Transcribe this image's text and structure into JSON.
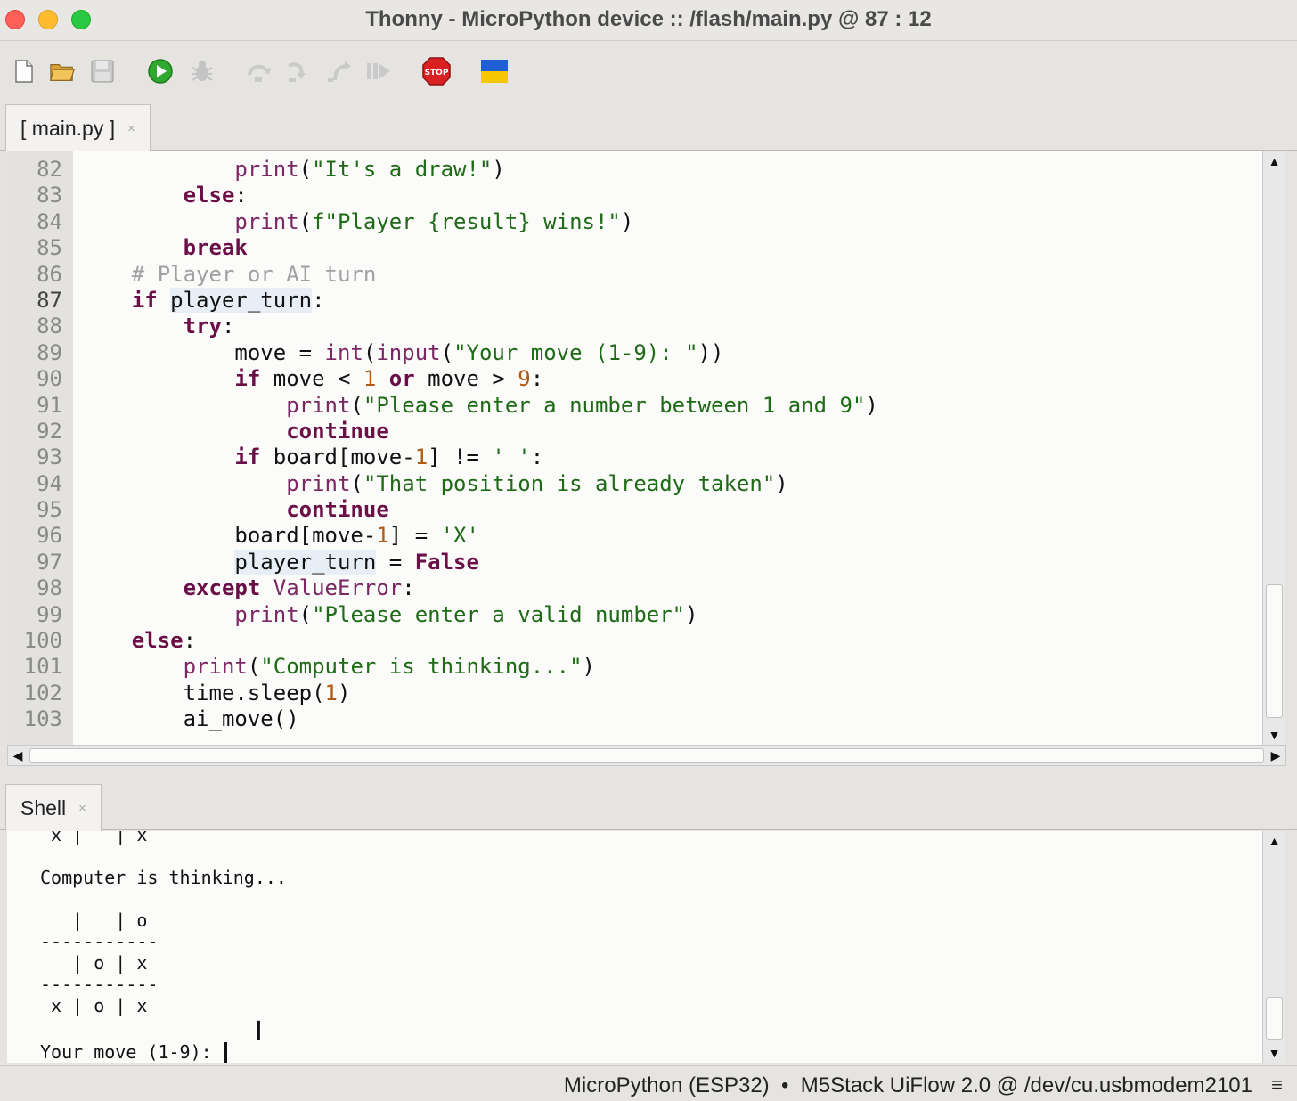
{
  "window": {
    "title": "Thonny  -  MicroPython device :: /flash/main.py  @  87 : 12"
  },
  "toolbar": {
    "buttons": [
      "new-file-icon",
      "open-file-icon",
      "save-icon",
      "run-icon",
      "debug-icon",
      "step-over-icon",
      "step-into-icon",
      "step-out-icon",
      "resume-icon",
      "stop-icon",
      "flag-icon"
    ],
    "stop_label": "STOP",
    "colors": {
      "run": "#2fa82f",
      "stop": "#d92121",
      "flag_blue": "#1f5fd6",
      "flag_yellow": "#f6c700"
    }
  },
  "editor": {
    "tab_label": "[ main.py ]",
    "tab_close": "×",
    "current_line": "87",
    "lines": [
      {
        "n": "82",
        "tokens": [
          [
            "",
            "            "
          ],
          [
            "bi",
            "print"
          ],
          [
            "",
            "("
          ],
          [
            "str",
            "\"It's a draw!\""
          ],
          [
            "",
            ")"
          ]
        ]
      },
      {
        "n": "83",
        "tokens": [
          [
            "",
            "        "
          ],
          [
            "kw",
            "else"
          ],
          [
            "",
            ":"
          ]
        ]
      },
      {
        "n": "84",
        "tokens": [
          [
            "",
            "            "
          ],
          [
            "bi",
            "print"
          ],
          [
            "",
            "("
          ],
          [
            "str",
            "f\"Player {result} wins!\""
          ],
          [
            "",
            ")"
          ]
        ]
      },
      {
        "n": "85",
        "tokens": [
          [
            "",
            "        "
          ],
          [
            "kw",
            "break"
          ]
        ]
      },
      {
        "n": "86",
        "tokens": [
          [
            "",
            "    "
          ],
          [
            "cm",
            "# Player or AI turn"
          ]
        ]
      },
      {
        "n": "87",
        "tokens": [
          [
            "",
            "    "
          ],
          [
            "kw",
            "if"
          ],
          [
            "",
            " "
          ],
          [
            "hl",
            "player_turn"
          ],
          [
            "",
            ":"
          ]
        ]
      },
      {
        "n": "88",
        "tokens": [
          [
            "",
            "        "
          ],
          [
            "kw",
            "try"
          ],
          [
            "",
            ":"
          ]
        ]
      },
      {
        "n": "89",
        "tokens": [
          [
            "",
            "            move = "
          ],
          [
            "bi",
            "int"
          ],
          [
            "",
            "("
          ],
          [
            "bi",
            "input"
          ],
          [
            "",
            "("
          ],
          [
            "str",
            "\"Your move (1-9): \""
          ],
          [
            "",
            "))"
          ]
        ]
      },
      {
        "n": "90",
        "tokens": [
          [
            "",
            "            "
          ],
          [
            "kw",
            "if"
          ],
          [
            "",
            " move < "
          ],
          [
            "num",
            "1"
          ],
          [
            "",
            " "
          ],
          [
            "kw",
            "or"
          ],
          [
            "",
            " move > "
          ],
          [
            "num",
            "9"
          ],
          [
            "",
            ":"
          ]
        ]
      },
      {
        "n": "91",
        "tokens": [
          [
            "",
            "                "
          ],
          [
            "bi",
            "print"
          ],
          [
            "",
            "("
          ],
          [
            "str",
            "\"Please enter a number between 1 and 9\""
          ],
          [
            "",
            ")"
          ]
        ]
      },
      {
        "n": "92",
        "tokens": [
          [
            "",
            "                "
          ],
          [
            "kw",
            "continue"
          ]
        ]
      },
      {
        "n": "93",
        "tokens": [
          [
            "",
            "            "
          ],
          [
            "kw",
            "if"
          ],
          [
            "",
            " board[move-"
          ],
          [
            "num",
            "1"
          ],
          [
            "",
            "] != "
          ],
          [
            "str",
            "' '"
          ],
          [
            "",
            ":"
          ]
        ]
      },
      {
        "n": "94",
        "tokens": [
          [
            "",
            "                "
          ],
          [
            "bi",
            "print"
          ],
          [
            "",
            "("
          ],
          [
            "str",
            "\"That position is already taken\""
          ],
          [
            "",
            ")"
          ]
        ]
      },
      {
        "n": "95",
        "tokens": [
          [
            "",
            "                "
          ],
          [
            "kw",
            "continue"
          ]
        ]
      },
      {
        "n": "96",
        "tokens": [
          [
            "",
            "            board[move-"
          ],
          [
            "num",
            "1"
          ],
          [
            "",
            "] = "
          ],
          [
            "str",
            "'X'"
          ]
        ]
      },
      {
        "n": "97",
        "tokens": [
          [
            "",
            "            "
          ],
          [
            "hl",
            "player_turn"
          ],
          [
            "",
            " = "
          ],
          [
            "kw",
            "False"
          ]
        ]
      },
      {
        "n": "98",
        "tokens": [
          [
            "",
            "        "
          ],
          [
            "kw",
            "except"
          ],
          [
            "",
            " "
          ],
          [
            "bi",
            "ValueError"
          ],
          [
            "",
            ":"
          ]
        ]
      },
      {
        "n": "99",
        "tokens": [
          [
            "",
            "            "
          ],
          [
            "bi",
            "print"
          ],
          [
            "",
            "("
          ],
          [
            "str",
            "\"Please enter a valid number\""
          ],
          [
            "",
            ")"
          ]
        ]
      },
      {
        "n": "100",
        "tokens": [
          [
            "",
            "    "
          ],
          [
            "kw",
            "else"
          ],
          [
            "",
            ":"
          ]
        ]
      },
      {
        "n": "101",
        "tokens": [
          [
            "",
            "        "
          ],
          [
            "bi",
            "print"
          ],
          [
            "",
            "("
          ],
          [
            "str",
            "\"Computer is thinking...\""
          ],
          [
            "",
            ")"
          ]
        ]
      },
      {
        "n": "102",
        "tokens": [
          [
            "",
            "        time.sleep("
          ],
          [
            "num",
            "1"
          ],
          [
            "",
            ")"
          ]
        ]
      },
      {
        "n": "103",
        "tokens": [
          [
            "",
            "        ai_move()"
          ]
        ]
      }
    ]
  },
  "shell": {
    "tab_label": "Shell",
    "tab_close": "×",
    "lines": [
      " x |   | x",
      "",
      "Computer is thinking...",
      "",
      "   |   | o",
      "-----------",
      "   | o | x",
      "-----------",
      " x | o | x",
      ""
    ],
    "prompt": "Your move (1-9): "
  },
  "status": {
    "interpreter": "MicroPython (ESP32)  •  M5Stack UiFlow 2.0 @ /dev/cu.usbmodem2101",
    "menu_icon": "≡"
  }
}
